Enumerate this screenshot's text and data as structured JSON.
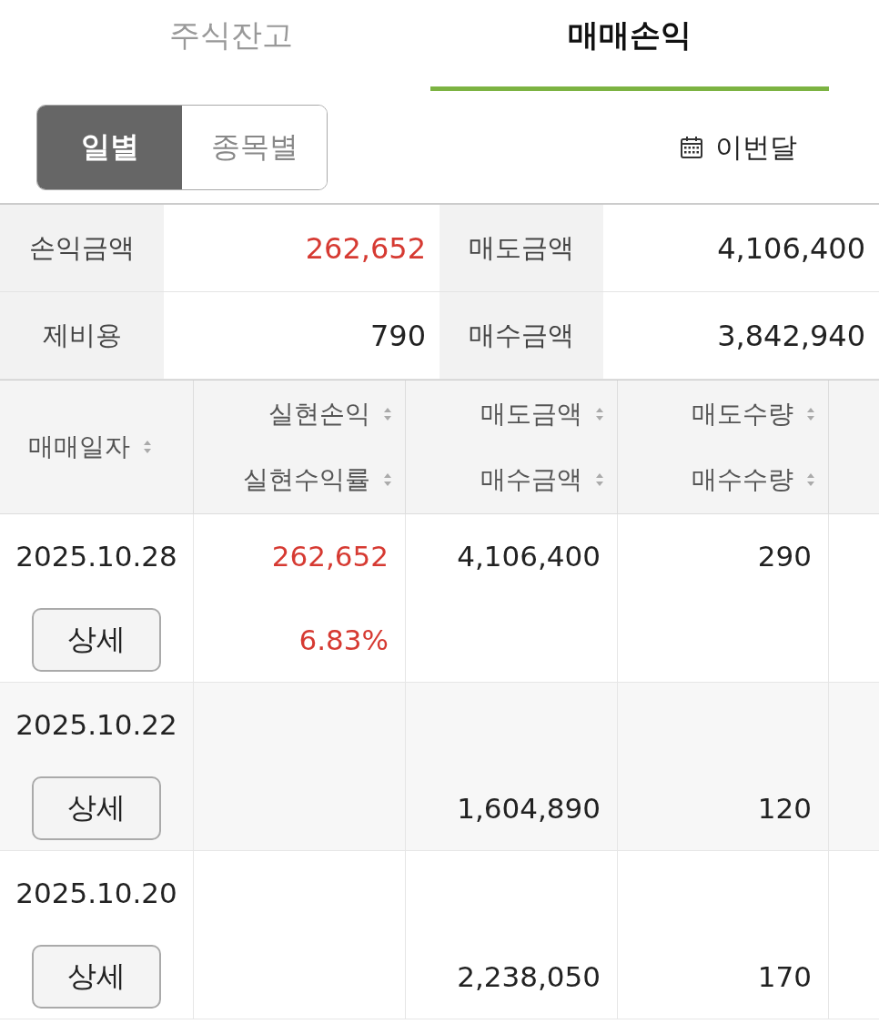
{
  "tabs": [
    {
      "label": "주식잔고",
      "selected": false
    },
    {
      "label": "매매손익",
      "selected": true
    }
  ],
  "period_toggle": [
    {
      "label": "일별",
      "selected": true
    },
    {
      "label": "종목별",
      "selected": false
    }
  ],
  "period_filter": {
    "label": "이번달"
  },
  "summary": [
    {
      "label": "손익금액",
      "value": "262,652",
      "positive": true
    },
    {
      "label": "매도금액",
      "value": "4,106,400",
      "positive": false
    },
    {
      "label": "제비용",
      "value": "790",
      "positive": false
    },
    {
      "label": "매수금액",
      "value": "3,842,940",
      "positive": false
    }
  ],
  "table": {
    "columns": [
      {
        "labels": [
          "매매일자"
        ]
      },
      {
        "labels": [
          "실현손익",
          "실현수익률"
        ]
      },
      {
        "labels": [
          "매도금액",
          "매수금액"
        ]
      },
      {
        "labels": [
          "매도수량",
          "매수수량"
        ]
      }
    ],
    "rows": [
      {
        "date": "2025.10.28",
        "button": "상세",
        "profit": "262,652",
        "rate": "6.83%",
        "positive": true,
        "sell_amount": "4,106,400",
        "sell_qty": "290"
      },
      {
        "date": "2025.10.22",
        "button": "상세",
        "buy_amount": "1,604,890",
        "buy_qty": "120"
      },
      {
        "date": "2025.10.20",
        "button": "상세",
        "buy_amount": "2,238,050",
        "buy_qty": "170"
      }
    ]
  }
}
